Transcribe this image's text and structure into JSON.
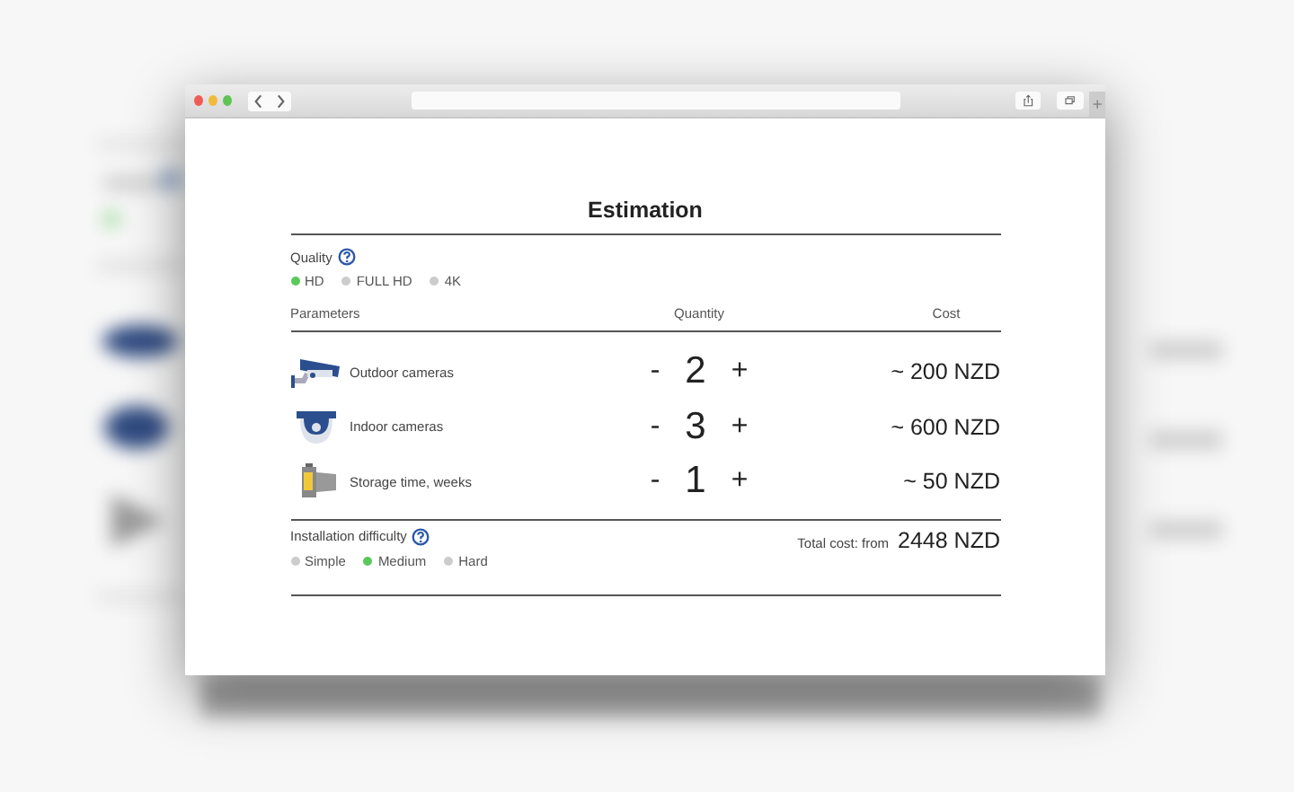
{
  "title": "Estimation",
  "quality": {
    "label": "Quality",
    "options": [
      {
        "label": "HD",
        "selected": true
      },
      {
        "label": "FULL HD",
        "selected": false
      },
      {
        "label": "4K",
        "selected": false
      }
    ]
  },
  "table": {
    "columns": [
      "Parameters",
      "Quantity",
      "Cost"
    ],
    "rows": [
      {
        "kind": "outdoor",
        "name": "Outdoor cameras",
        "minus": "-",
        "quantity": "2",
        "plus": "+",
        "cost": "~ 200 NZD"
      },
      {
        "kind": "indoor",
        "name": "Indoor cameras",
        "minus": "-",
        "quantity": "3",
        "plus": "+",
        "cost": "~ 600 NZD"
      },
      {
        "kind": "storage",
        "name": "Storage time, weeks",
        "minus": "-",
        "quantity": "1",
        "plus": "+",
        "cost": "~ 50 NZD"
      }
    ]
  },
  "difficulty": {
    "label": "Installation difficulty",
    "options": [
      {
        "label": "Simple",
        "selected": false
      },
      {
        "label": "Medium",
        "selected": true
      },
      {
        "label": "Hard",
        "selected": false
      }
    ]
  },
  "total": {
    "label": "Total cost: from",
    "value": "2448 NZD"
  }
}
